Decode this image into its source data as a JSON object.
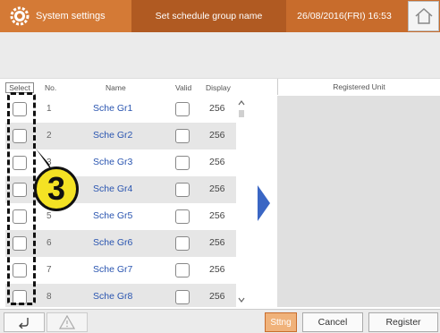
{
  "header": {
    "title": "System settings",
    "screen": "Set schedule group name",
    "datetime": "26/08/2016(FRI) 16:53"
  },
  "table": {
    "headers": {
      "select": "Select",
      "no": "No.",
      "name": "Name",
      "valid": "Valid",
      "display": "Display"
    },
    "rows": [
      {
        "no": "1",
        "name": "Sche Gr1",
        "display": "256"
      },
      {
        "no": "2",
        "name": "Sche Gr2",
        "display": "256"
      },
      {
        "no": "3",
        "name": "Sche Gr3",
        "display": "256"
      },
      {
        "no": "4",
        "name": "Sche Gr4",
        "display": "256"
      },
      {
        "no": "5",
        "name": "Sche Gr5",
        "display": "256"
      },
      {
        "no": "6",
        "name": "Sche Gr6",
        "display": "256"
      },
      {
        "no": "7",
        "name": "Sche Gr7",
        "display": "256"
      },
      {
        "no": "8",
        "name": "Sche Gr8",
        "display": "256"
      }
    ]
  },
  "registered": {
    "title": "Registered Unit"
  },
  "callout": {
    "number": "3"
  },
  "footer": {
    "sttng": "Sttng",
    "cancel": "Cancel",
    "register": "Register"
  },
  "colors": {
    "header": "#c86c2c",
    "accent": "#2a55b0",
    "arrow": "#3a66c4",
    "callout": "#f4e224"
  }
}
